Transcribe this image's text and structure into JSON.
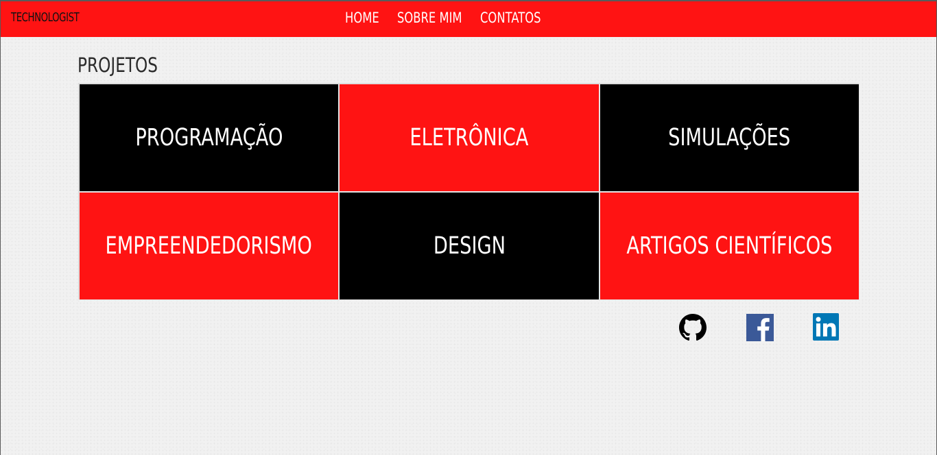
{
  "navbar": {
    "brand": "TECHNOLOGIST",
    "links": [
      "HOME",
      "SOBRE MIM",
      "CONTATOS"
    ],
    "background_color": "#ff1313"
  },
  "section": {
    "title": "PROJETOS"
  },
  "projects": [
    {
      "label": "PROGRAMAÇÃO",
      "color": "#000000"
    },
    {
      "label": "ELETRÔNICA",
      "color": "#ff1313"
    },
    {
      "label": "SIMULAÇÕES",
      "color": "#000000"
    },
    {
      "label": "EMPREENDEDORISMO",
      "color": "#ff1313"
    },
    {
      "label": "DESIGN",
      "color": "#000000"
    },
    {
      "label": "ARTIGOS CIENTÍFICOS",
      "color": "#ff1313"
    }
  ],
  "social": [
    {
      "icon": "github-icon",
      "color": "#000000"
    },
    {
      "icon": "facebook-icon",
      "color": "#3b5998"
    },
    {
      "icon": "linkedin-icon",
      "color": "#0077b5"
    }
  ]
}
